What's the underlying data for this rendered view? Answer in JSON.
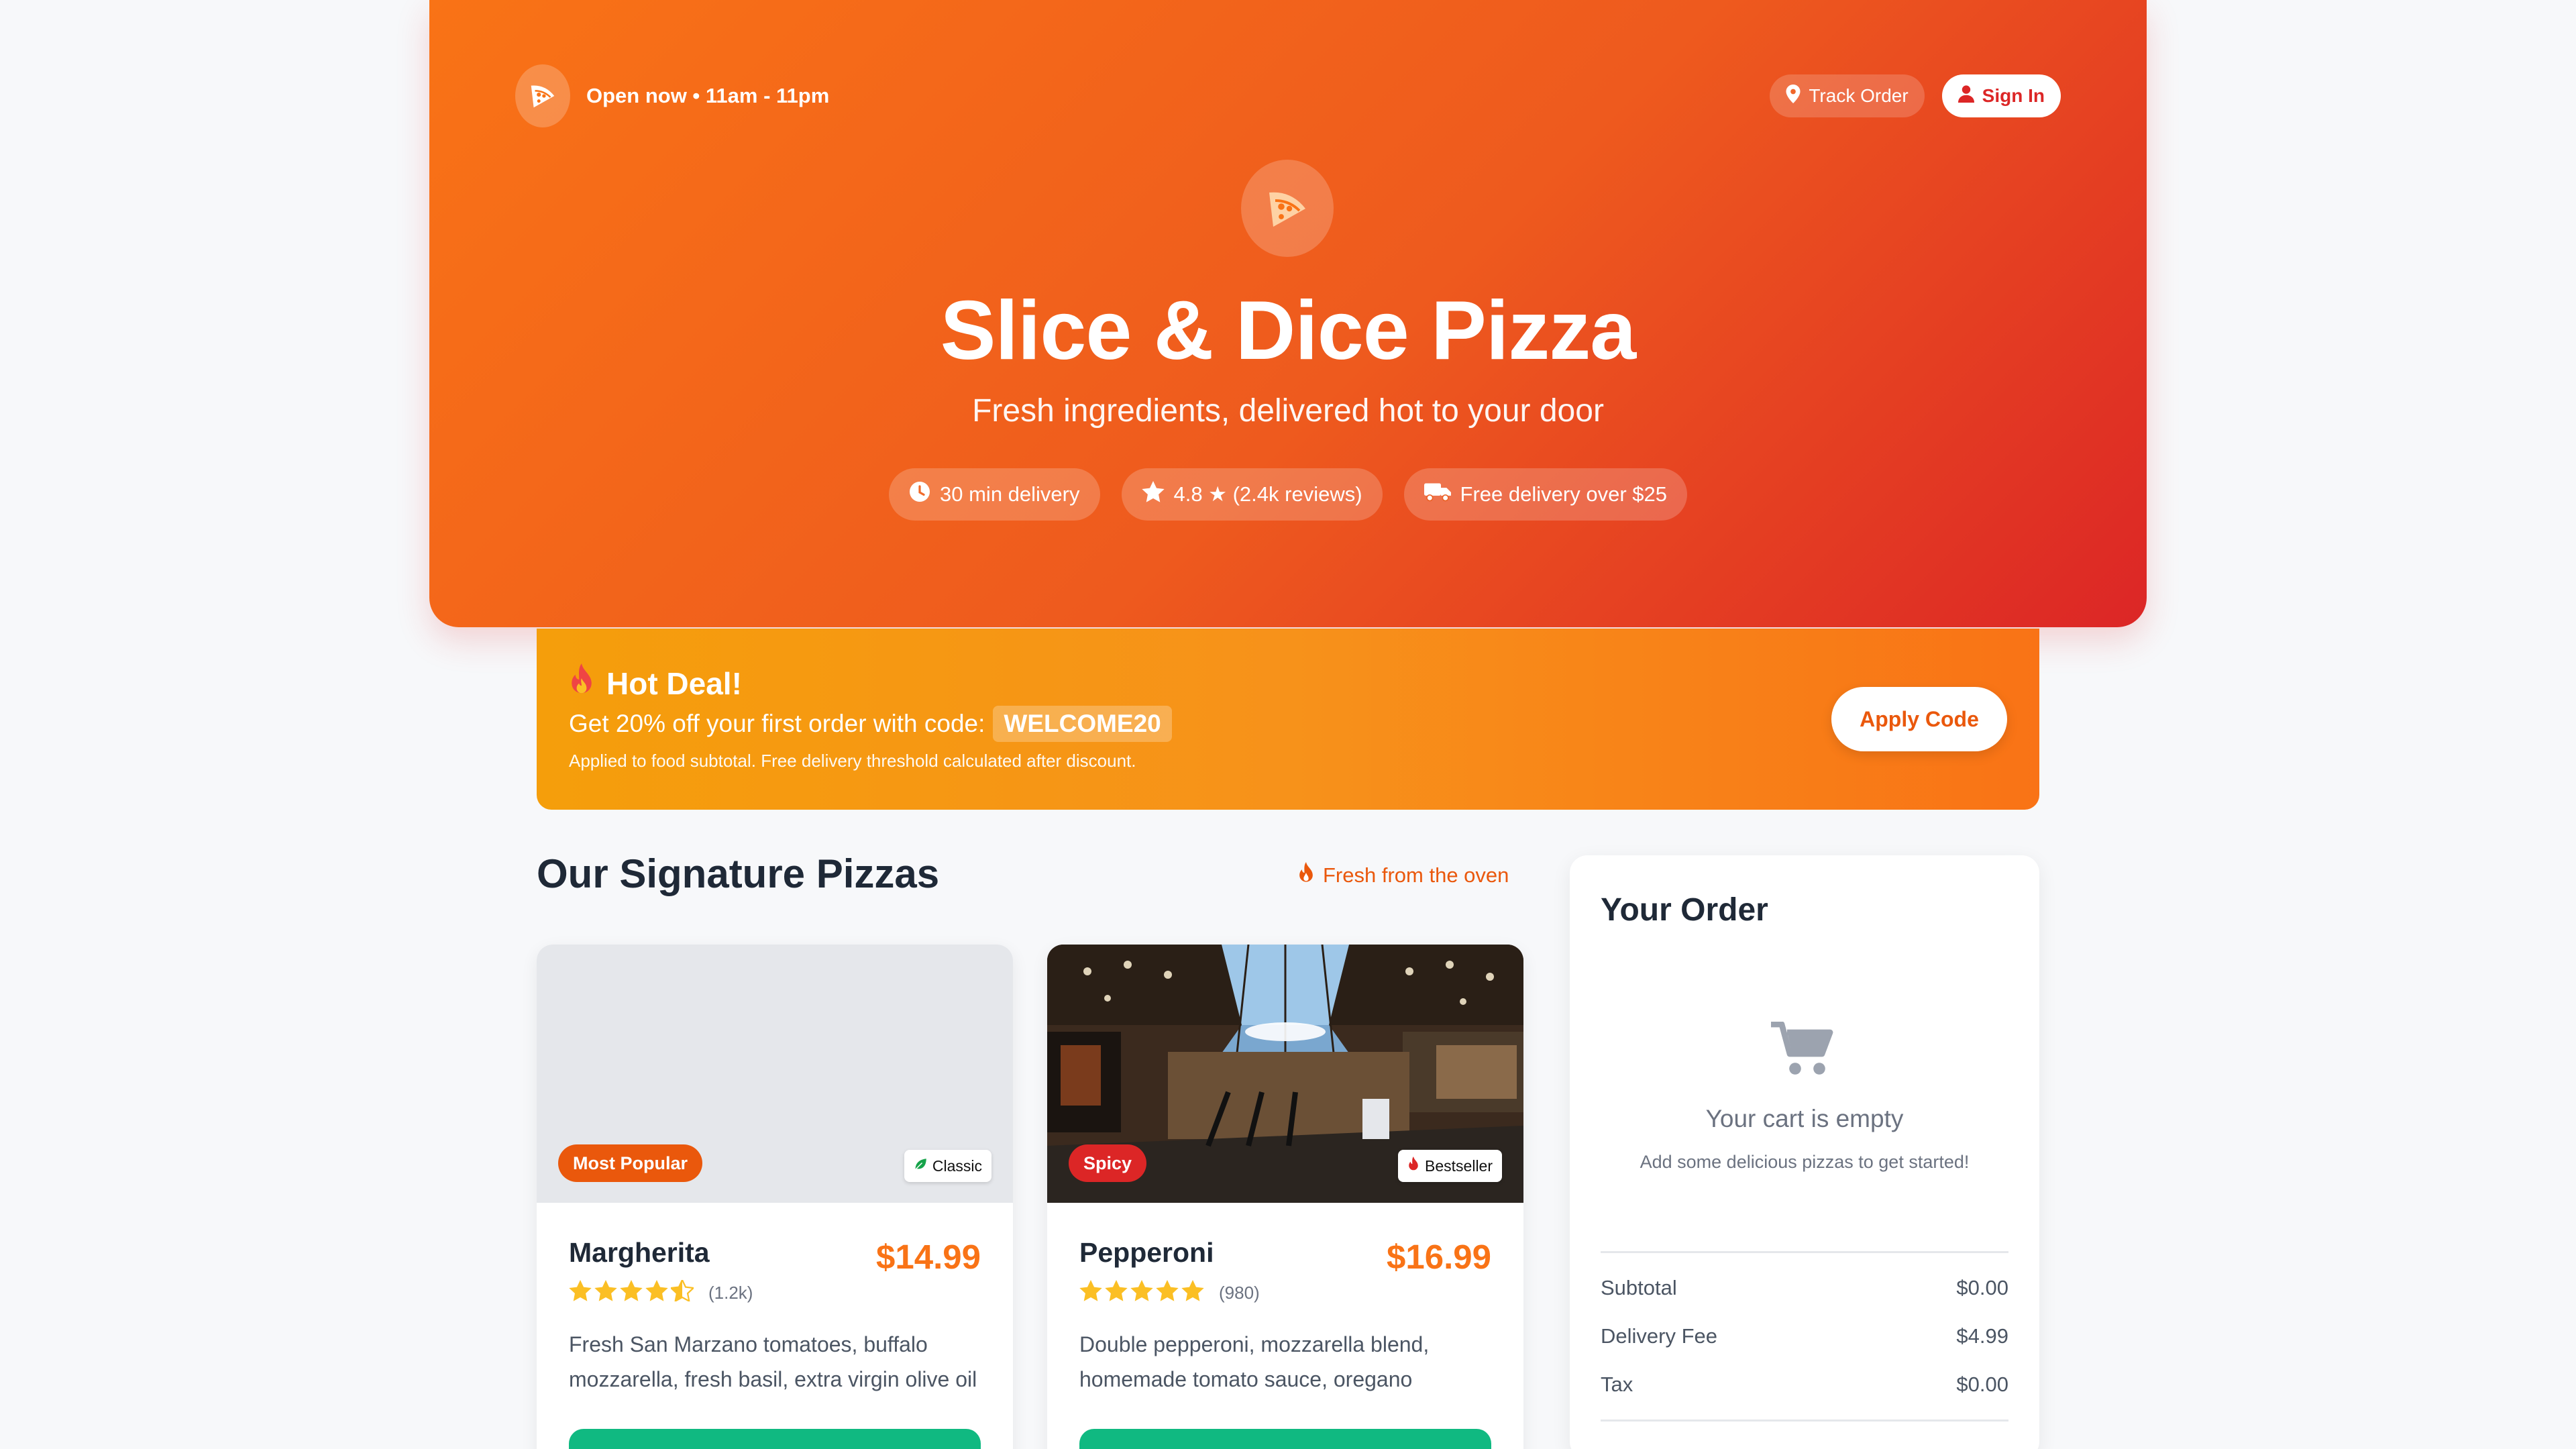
{
  "header": {
    "status": "Open now • 11am - 11pm",
    "track_order": "Track Order",
    "sign_in": "Sign In",
    "title": "Slice & Dice Pizza",
    "subtitle": "Fresh ingredients, delivered hot to your door",
    "pills": [
      {
        "icon": "clock-icon",
        "label": "30 min delivery"
      },
      {
        "icon": "star-icon",
        "label": "4.8 ★ (2.4k reviews)"
      },
      {
        "icon": "truck-icon",
        "label": "Free delivery over $25"
      }
    ]
  },
  "deal": {
    "icon": "fire-icon",
    "title": "Hot Deal!",
    "text": "Get 20% off your first order with code:",
    "code": "WELCOME20",
    "note": "Applied to food subtotal. Free delivery threshold calculated after discount.",
    "button": "Apply Code"
  },
  "menu": {
    "title": "Our Signature Pizzas",
    "fresh_label": "Fresh from the oven",
    "items": [
      {
        "badge": "Most Popular",
        "badge_color": "#ea580c",
        "tag": "Classic",
        "tag_icon": "leaf-icon",
        "name": "Margherita",
        "price": "$14.99",
        "rating": 4.5,
        "reviews": "(1.2k)",
        "desc": "Fresh San Marzano tomatoes, buffalo mozzarella, fresh basil, extra virgin olive oil"
      },
      {
        "badge": "Spicy",
        "badge_color": "#dc2626",
        "tag": "Bestseller",
        "tag_icon": "fire-icon",
        "name": "Pepperoni",
        "price": "$16.99",
        "rating": 5,
        "reviews": "(980)",
        "desc": "Double pepperoni, mozzarella blend, homemade tomato sauce, oregano"
      }
    ]
  },
  "order": {
    "title": "Your Order",
    "empty_title": "Your cart is empty",
    "empty_sub": "Add some delicious pizzas to get started!",
    "rows": [
      {
        "label": "Subtotal",
        "value": "$0.00"
      },
      {
        "label": "Delivery Fee",
        "value": "$4.99"
      },
      {
        "label": "Tax",
        "value": "$0.00"
      }
    ]
  },
  "colors": {
    "accent": "#f97316",
    "red": "#dc2626",
    "green": "#10b981",
    "star": "#fbbf24"
  }
}
